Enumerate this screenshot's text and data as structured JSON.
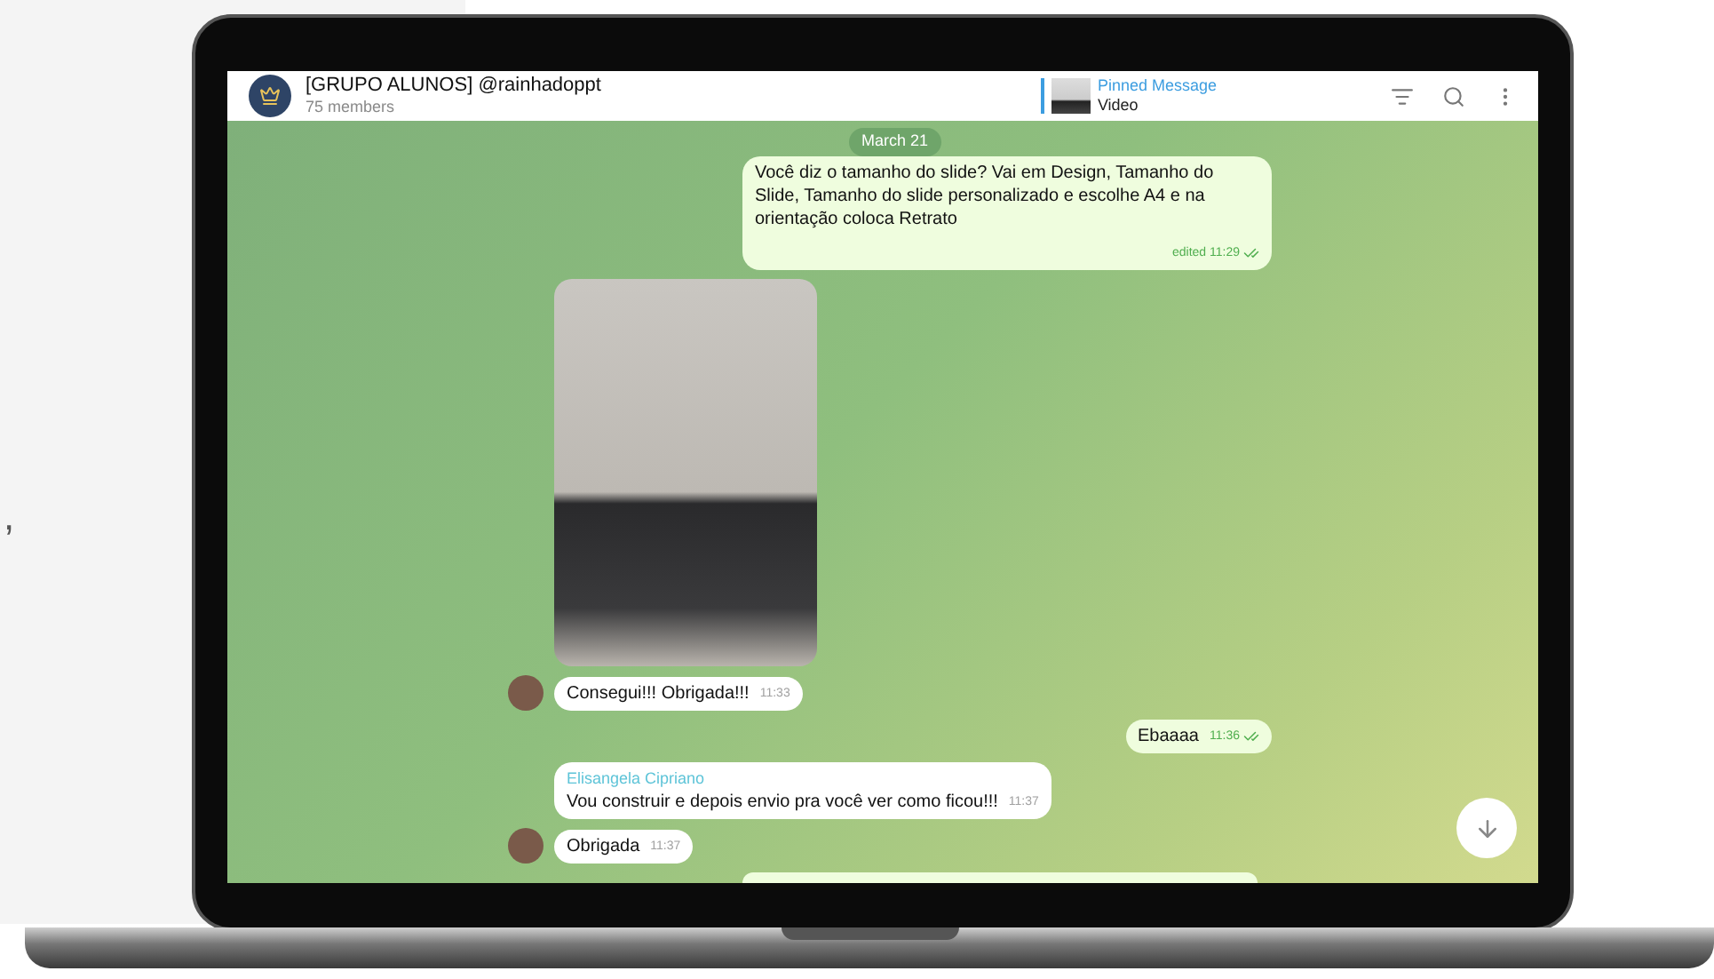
{
  "page_fragment": ",",
  "header": {
    "title": "[GRUPO ALUNOS] @rainhadoppt",
    "subtitle": "75 members",
    "pinned": {
      "label": "Pinned Message",
      "text": "Video"
    }
  },
  "date_badge": "March 21",
  "messages": [
    {
      "kind": "text",
      "outgoing": true,
      "text": "Você diz o tamanho do slide? Vai em Design, Tamanho do Slide, Tamanho do slide personalizado e escolhe A4 e na orientação coloca Retrato",
      "time": "edited 11:29",
      "read": true
    },
    {
      "kind": "photo",
      "outgoing": false,
      "avatar": false
    },
    {
      "kind": "text",
      "outgoing": false,
      "avatar": true,
      "text": "Consegui!!! Obrigada!!!",
      "time": "11:33"
    },
    {
      "kind": "text",
      "outgoing": true,
      "text": "Ebaaaa",
      "time": "11:36",
      "read": true
    },
    {
      "kind": "text",
      "outgoing": false,
      "avatar": false,
      "sender": "Elisangela Cipriano",
      "text": "Vou construir e depois envio pra você ver como ficou!!!",
      "time": "11:37"
    },
    {
      "kind": "text",
      "outgoing": false,
      "avatar": true,
      "text": "Obrigada",
      "time": "11:37"
    },
    {
      "kind": "partial",
      "outgoing": true
    }
  ]
}
